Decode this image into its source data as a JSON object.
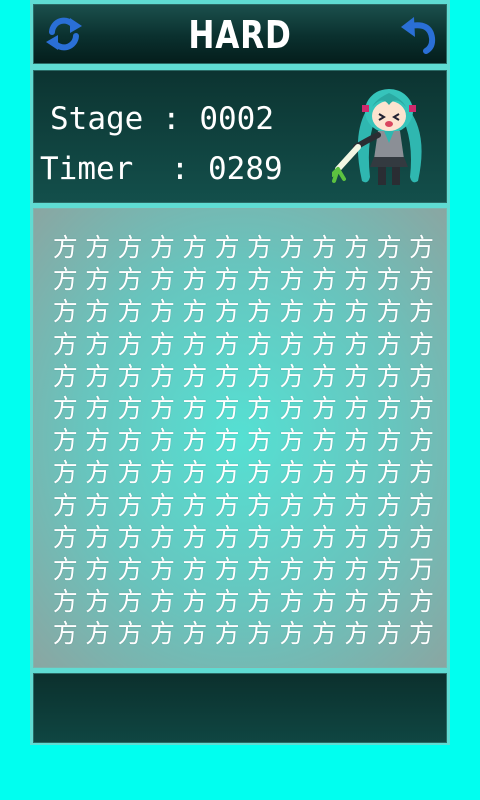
{
  "header": {
    "title": "HARD",
    "left_icon": "refresh-icon",
    "right_icon": "undo-icon"
  },
  "info": {
    "stage_label": "Stage",
    "stage_value": "0002",
    "timer_label": "Timer",
    "timer_value": "0289",
    "separator": ":",
    "mascot": "chibi-character-with-leek"
  },
  "grid": {
    "columns": 12,
    "rows": 13,
    "base_char": "方",
    "odd_char": "万",
    "odd_position": {
      "row": 10,
      "col": 11
    }
  },
  "colors": {
    "background": "#00fff0",
    "panel_dark": "#0a302e",
    "grid_center": "#55e0d3",
    "text": "#ffffff",
    "icon_blue": "#2a6fd6"
  }
}
